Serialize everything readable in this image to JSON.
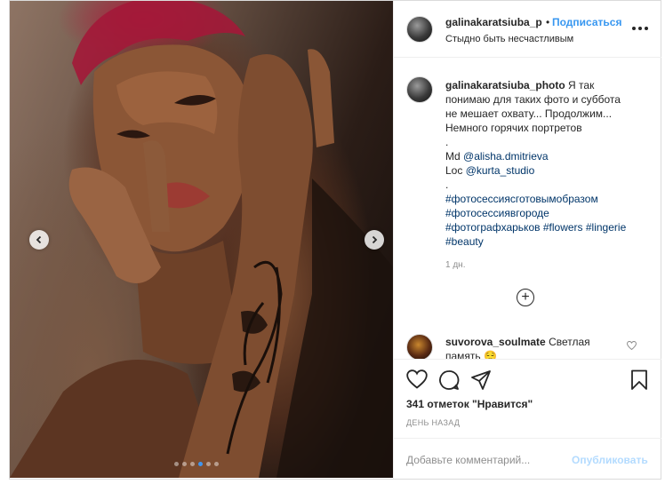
{
  "post": {
    "username": "galinakaratsiuba_p",
    "bullet": "•",
    "follow_label": "Подписаться",
    "location": "Стыдно быть несчастливым",
    "more_icon": "more-horizontal-icon"
  },
  "caption": {
    "username": "galinakaratsiuba_photo",
    "text_lines": [
      "Я так",
      "понимаю для таких фото и суббота",
      "не мешает охвату... Продолжим...",
      "Немного горячих портретов",
      ".",
      "Md",
      "@alisha.dmitrieva",
      "Loc",
      "@kurta_studio",
      "."
    ],
    "hashtags": [
      "#фотосессиясготовымобразом",
      "#фотосессиявгороде",
      "#фотографхарьков",
      "#flowers",
      "#lingerie",
      "#beauty"
    ],
    "time_ago": "1 дн."
  },
  "load_more_label": "+",
  "comment": {
    "username": "suvorova_soulmate",
    "text": "Светлая память 😌"
  },
  "actions": {
    "likes": "341 отметок \"Нравится\"",
    "date": "ДЕНЬ НАЗАД",
    "comment_placeholder": "Добавьте комментарий...",
    "publish_label": "Опубликовать"
  },
  "carousel": {
    "total_slides": 6,
    "active_slide": 4
  },
  "colors": {
    "accent": "#3897f0",
    "publish_disabled": "#b3dbff",
    "link": "#003569",
    "muted": "#8e8e8e"
  }
}
